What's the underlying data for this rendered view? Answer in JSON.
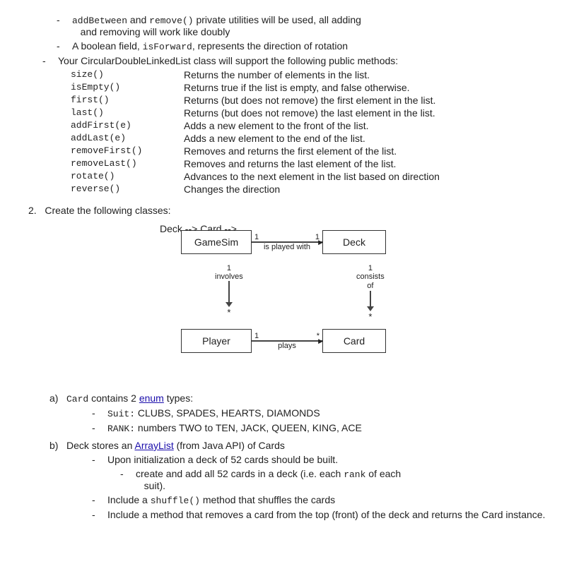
{
  "content": {
    "bullet_intro": [
      {
        "id": "b1",
        "text_parts": [
          {
            "type": "mono",
            "text": "addBetween"
          },
          {
            "type": "normal",
            "text": " and "
          },
          {
            "type": "mono",
            "text": "remove()"
          },
          {
            "type": "normal",
            "text": " private utilities will be used, all adding"
          }
        ],
        "continuation": "and removing will work like doubly"
      },
      {
        "id": "b2",
        "text_parts": [
          {
            "type": "normal",
            "text": "A boolean field, "
          },
          {
            "type": "mono",
            "text": "isForward"
          },
          {
            "type": "normal",
            "text": ", represents the direction of rotation"
          }
        ]
      }
    ],
    "public_methods_intro": "Your CircularDoubleLinkedList class will support the following public methods:",
    "methods": [
      {
        "name": "size()",
        "desc": "Returns the number of elements in the list."
      },
      {
        "name": "isEmpty()",
        "desc": "Returns true if the list is empty, and false otherwise."
      },
      {
        "name": "first()",
        "desc": "Returns (but does not remove) the first element in the list."
      },
      {
        "name": "last()",
        "desc": "Returns (but does not remove) the last element in the list."
      },
      {
        "name": "addFirst(e)",
        "desc": "Adds a new element to the front of the list."
      },
      {
        "name": "addLast(e)",
        "desc": "Adds a new element to the end of the list."
      },
      {
        "name": "removeFirst()",
        "desc": "Removes and returns the first element of the list."
      },
      {
        "name": "removeLast()",
        "desc": "Removes and returns the last element of the list."
      },
      {
        "name": "rotate()",
        "desc": "Advances to the next element in the list based on direction"
      },
      {
        "name": "reverse()",
        "desc": "Changes the direction"
      }
    ],
    "section2_label": "2.",
    "section2_text": "Create the following classes:",
    "uml": {
      "gamesim_label": "GameSim",
      "deck_label": "Deck",
      "player_label": "Player",
      "card_label": "Card",
      "top_arrow_label_left": "1",
      "top_arrow_label_right": "1",
      "top_arrow_middle": "is played with",
      "left_vert_label": "involves",
      "left_vert_num": "1",
      "left_vert_star": "*",
      "right_vert_label": "consists",
      "right_vert_label2": "of",
      "right_vert_num": "1",
      "right_vert_star": "*",
      "bottom_arrow_label_left": "1",
      "bottom_arrow_label_right": "*",
      "bottom_arrow_middle": "plays"
    },
    "part_a": {
      "label": "a)",
      "text_parts": [
        {
          "type": "mono",
          "text": "Card"
        },
        {
          "type": "normal",
          "text": " contains 2 "
        },
        {
          "type": "link",
          "text": "enum"
        },
        {
          "type": "normal",
          "text": " types:"
        }
      ],
      "bullets": [
        {
          "mono_prefix": "Suit:",
          "text": " CLUBS, SPADES, HEARTS, DIAMONDS"
        },
        {
          "mono_prefix": "RANK:",
          "text": " numbers TWO to TEN, JACK, QUEEN, KING, ACE"
        }
      ]
    },
    "part_b": {
      "label": "b)",
      "text_parts": [
        {
          "type": "normal",
          "text": "Deck stores an "
        },
        {
          "type": "link",
          "text": "ArrayList"
        },
        {
          "type": "normal",
          "text": " (from Java API) of Cards"
        }
      ],
      "bullets": [
        {
          "text": "Upon initialization a deck of 52 cards should be built.",
          "sub_bullets": [
            "create and add all 52 cards in a deck (i.e. each ",
            "rank",
            " of each suit)."
          ]
        },
        {
          "text_parts": [
            {
              "type": "normal",
              "text": "Include a "
            },
            {
              "type": "mono",
              "text": "shuffle()"
            },
            {
              "type": "normal",
              "text": " method that shuffles the cards"
            }
          ]
        },
        {
          "text": "Include a method that removes a card from the top (front) of the deck and returns the Card instance."
        }
      ]
    }
  }
}
